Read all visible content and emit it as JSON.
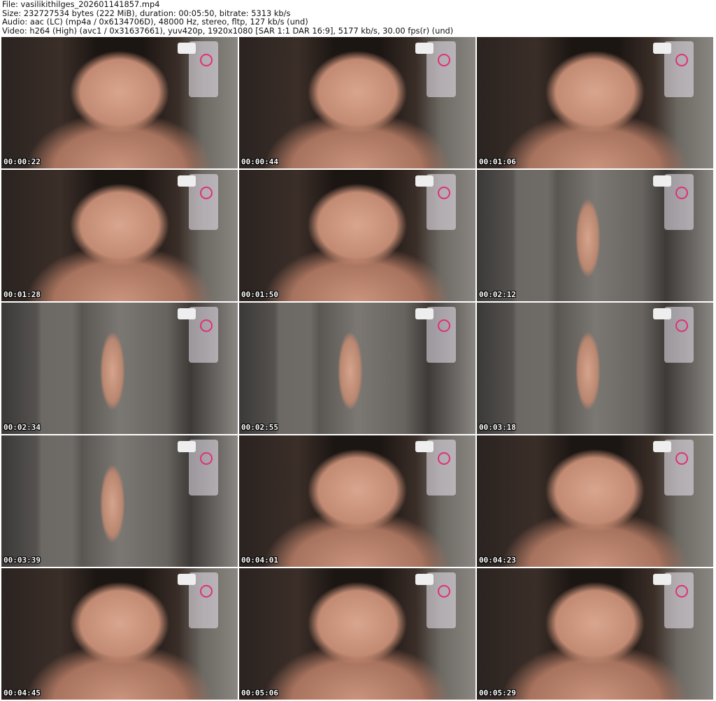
{
  "header": {
    "file": "File: vasilikithilges_202601141857.mp4",
    "size": "Size: 232727534 bytes (222 MiB), duration: 00:05:50, bitrate: 5313 kb/s",
    "audio": "Audio: aac (LC) (mp4a / 0x6134706D), 48000 Hz, stereo, fltp, 127 kb/s (und)",
    "video": "Video: h264 (High) (avc1 / 0x31637661), yuv420p, 1920x1080 [SAR 1:1 DAR 16:9], 5177 kb/s, 30.00 fps(r) (und)"
  },
  "thumbnails": [
    {
      "timestamp": "00:00:22",
      "shot": "close"
    },
    {
      "timestamp": "00:00:44",
      "shot": "close"
    },
    {
      "timestamp": "00:01:06",
      "shot": "close"
    },
    {
      "timestamp": "00:01:28",
      "shot": "close"
    },
    {
      "timestamp": "00:01:50",
      "shot": "close"
    },
    {
      "timestamp": "00:02:12",
      "shot": "full"
    },
    {
      "timestamp": "00:02:34",
      "shot": "full"
    },
    {
      "timestamp": "00:02:55",
      "shot": "full"
    },
    {
      "timestamp": "00:03:18",
      "shot": "full"
    },
    {
      "timestamp": "00:03:39",
      "shot": "full"
    },
    {
      "timestamp": "00:04:01",
      "shot": "close"
    },
    {
      "timestamp": "00:04:23",
      "shot": "close"
    },
    {
      "timestamp": "00:04:45",
      "shot": "close"
    },
    {
      "timestamp": "00:05:06",
      "shot": "close"
    },
    {
      "timestamp": "00:05:29",
      "shot": "close"
    }
  ]
}
